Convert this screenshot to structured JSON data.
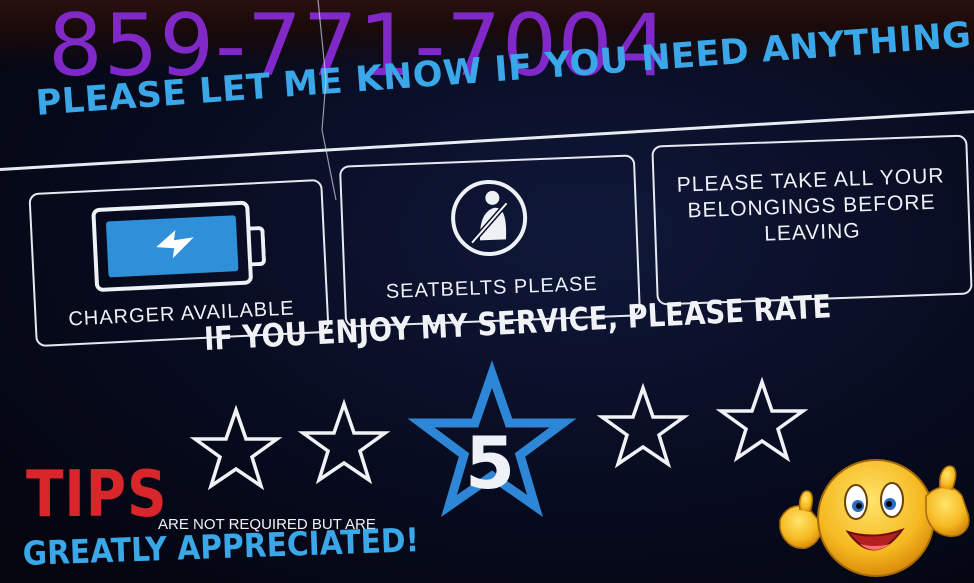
{
  "phone_number": "859-771-7004",
  "headline": "PLEASE LET ME KNOW IF YOU NEED ANYTHING",
  "cards": {
    "charger_label": "CHARGER AVAILABLE",
    "seatbelt_label": "SEATBELTS PLEASE",
    "belongings_text": "PLEASE TAKE ALL YOUR BELONGINGS BEFORE LEAVING"
  },
  "rating": {
    "prompt": "IF YOU ENJOY MY SERVICE, PLEASE RATE",
    "highlighted_star_value": "5",
    "star_count": 5
  },
  "tips": {
    "heading": "TIPS",
    "small_text": "ARE NOT REQUIRED BUT ARE",
    "appreciated_text": "GREATLY APPRECIATED!"
  },
  "colors": {
    "phone": "#8a2bd8",
    "headline_blue": "#3aa7e8",
    "tips_red": "#d8262b",
    "battery_blue": "#2f8fd8",
    "star_highlight": "#2e86d6"
  },
  "icons": [
    "battery-charging-icon",
    "seatbelt-icon",
    "star-icon",
    "thumbs-up-emoji-icon"
  ]
}
